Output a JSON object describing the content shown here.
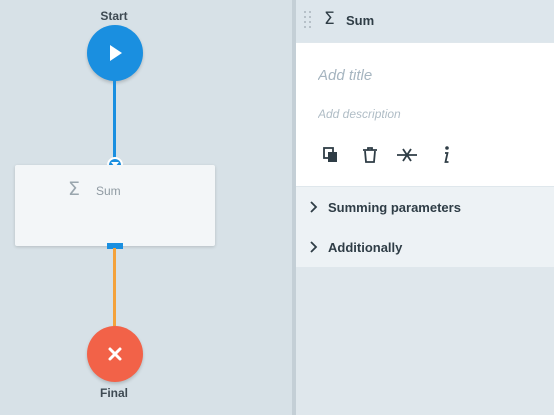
{
  "canvas": {
    "start": {
      "label": "Start"
    },
    "block": {
      "title": "Sum"
    },
    "final": {
      "label": "Final"
    }
  },
  "panel": {
    "header": {
      "title": "Sum",
      "icon": "sigma-icon"
    },
    "title_placeholder": "Add title",
    "description_placeholder": "Add description",
    "tools": [
      "copy-icon",
      "delete-icon",
      "disconnect-icon",
      "info-icon"
    ],
    "sections": [
      {
        "label": "Summing parameters"
      },
      {
        "label": "Additionally"
      }
    ]
  },
  "colors": {
    "start": "#1a8fe0",
    "final": "#f26248",
    "incoming_line": "#1a8fe0",
    "outgoing_line": "#f4a23b"
  }
}
